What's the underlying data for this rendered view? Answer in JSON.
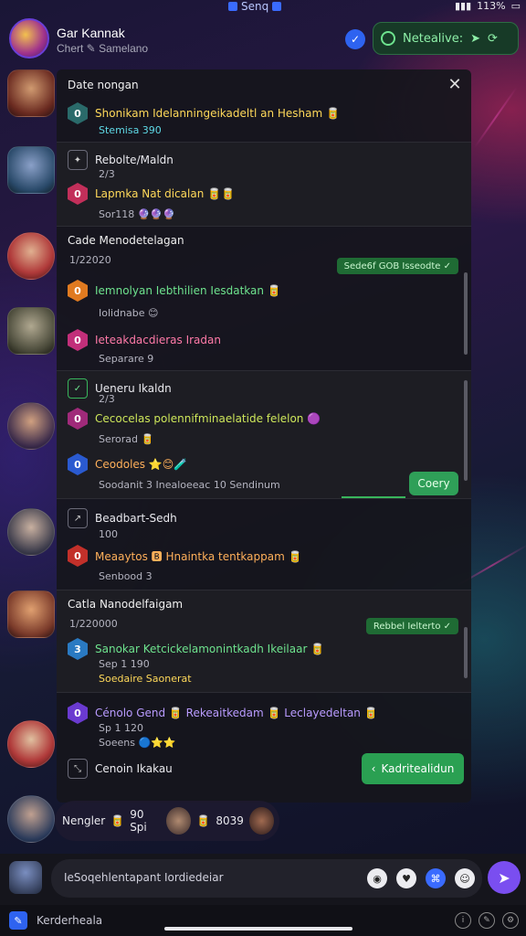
{
  "statusbar": {
    "center_text": "Senq",
    "battery": "113%"
  },
  "header": {
    "title": "Gar Kannak",
    "subtitle": "Chert ✎ Samelano",
    "live_label": "Netealive:"
  },
  "panel": {
    "sections": [
      {
        "title": "Date nongan",
        "rows": [
          {
            "badge": "0",
            "text": "Shonikam Idelanningeikadeltl an Hesham 🥫",
            "meta": "Stemisa 390"
          }
        ]
      },
      {
        "title": "Rebolte/Maldn",
        "sub": "2/3",
        "rows": [
          {
            "badge": "0",
            "text": "Lapmka Nat dicalan 🥫🥫",
            "meta": "Sor118 🔮🔮🔮"
          }
        ]
      },
      {
        "title": "Cade Menodetelagan",
        "sub": "1/22020",
        "pill": "Sede6f GOB Isseodte ✓",
        "rows": [
          {
            "badge": "0",
            "text": "Iemnolyan Iebthilien Iesdatkan 🥫",
            "meta": "Iolidnabe 😊"
          },
          {
            "badge": "0",
            "text": "Ieteakdacdieras Iradan",
            "meta": "Separare 9"
          }
        ]
      },
      {
        "title": "Ueneru Ikaldn",
        "sub": "2/3",
        "rows": [
          {
            "badge": "0",
            "text": "Cecocelas polennifminaelatide felelon 🟣",
            "meta": "Serorad 🥫"
          },
          {
            "badge": "0",
            "text": "Ceodoles ⭐😊🧪",
            "meta": "Soodanit 3 Inealoeeac 10 Sendinum"
          }
        ],
        "copy": "Coery"
      },
      {
        "title": "Beadbart-Sedh",
        "sub": "100",
        "rows": [
          {
            "badge": "0",
            "text": "Meaaytos 🅱 Hnaintka tentkappam 🥫",
            "meta": "Senbood 3"
          }
        ]
      },
      {
        "title": "Catla Nanodelfaigam",
        "sub": "1/220000",
        "pill": "Rebbel Ielterto ✓",
        "rows": [
          {
            "badge": "3",
            "text": "Sanokar Ketcickelamonintkadh Ikeilaar 🥫",
            "meta": "Sep 1 190",
            "meta2": "Soedaire Saonerat"
          }
        ]
      },
      {
        "title": "",
        "rows": [
          {
            "badge": "0",
            "text": "Cénolo Gend 🥫 Rekeaitkedam 🥫 Leclayedeltan 🥫",
            "meta": "Sp 1 120",
            "meta2": "Soeens 🔵⭐⭐"
          }
        ],
        "footer": "Cenoin Ikakau",
        "cta": "Kadritealidun"
      }
    ]
  },
  "reactions": {
    "label": "Nengler",
    "count1": "90 Spi",
    "count2": "8039"
  },
  "composer": {
    "placeholder": "IeSoqehlentapant Iordiedeiar"
  },
  "navbar": {
    "label": "Kerderheala"
  },
  "colors": {
    "accent": "#7a4ef0",
    "success": "#2aa052",
    "brand": "#2e63f0"
  }
}
